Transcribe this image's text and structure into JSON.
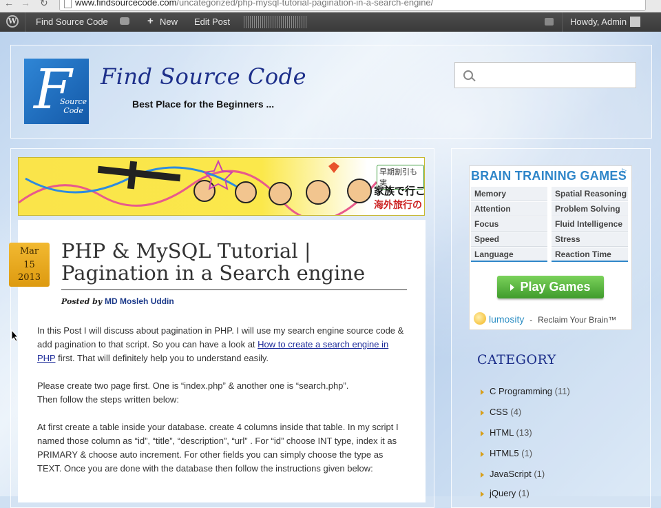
{
  "browser": {
    "url_domain": "www.findsourcecode.com",
    "url_path": "/uncategorized/php-mysql-tutorial-pagination-in-a-search-engine/"
  },
  "adminbar": {
    "site_name": "Find Source Code",
    "new_label": "New",
    "edit_label": "Edit Post",
    "howdy": "Howdy, Admin"
  },
  "header": {
    "title": "Find Source Code",
    "tagline": "Best Place for the Beginners ...",
    "logo_letter": "F",
    "logo_sub_1": "Source",
    "logo_sub_2": "Code"
  },
  "banner": {
    "jp_badge": "早期割引も実",
    "jp_line1": "家族で行こ",
    "jp_line2": "海外旅行の"
  },
  "post": {
    "date_month": "Mar",
    "date_day": "15",
    "date_year": "2013",
    "title": "PHP & MySQL Tutorial | Pagination in a Search engine",
    "posted_by": "Posted by",
    "author": "MD Mosleh Uddin",
    "p1_a": "In this Post I will discuss about pagination in PHP. I will use my search engine source code & add pagination to that script. So you can have a look at ",
    "p1_link": "How to create a search engine in PHP",
    "p1_b": " first. That will definitely help you to understand easily.",
    "p2_line1": "Please create two page first. One is “index.php” & another one is “search.php”.",
    "p2_line2": "Then follow the steps written below:",
    "p3": "At first create a table inside your database. create 4 columns inside that table. In my script I named those column as “id”, “title”, “description”, “url” . For “id” choose INT type, index it as PRIMARY & choose auto increment. For other fields you can simply choose the type as TEXT. Once you are done with the database then follow the instructions given below:"
  },
  "ad": {
    "title": "BRAIN TRAINING GAMES",
    "games_left": [
      "Memory",
      "Attention",
      "Focus",
      "Speed",
      "Language"
    ],
    "games_right": [
      "Spatial Reasoning",
      "Problem Solving",
      "Fluid Intelligence",
      "Stress",
      "Reaction Time"
    ],
    "play_label": "Play Games",
    "brand": "lumosity",
    "dash": "-",
    "tagline": "Reclaim Your Brain™"
  },
  "category": {
    "title": "CATEGORY",
    "items": [
      {
        "name": "C Programming",
        "count": "(11)"
      },
      {
        "name": "CSS",
        "count": "(4)"
      },
      {
        "name": "HTML",
        "count": "(13)"
      },
      {
        "name": "HTML5",
        "count": "(1)"
      },
      {
        "name": "JavaScript",
        "count": "(1)"
      },
      {
        "name": "jQuery",
        "count": "(1)"
      }
    ]
  },
  "colors": {
    "admin_bar": "#464646",
    "title_blue": "#1d2f8a",
    "date_badge": "#e8a82a",
    "play_green": "#5cb83c",
    "ad_blue": "#2f86c9"
  }
}
